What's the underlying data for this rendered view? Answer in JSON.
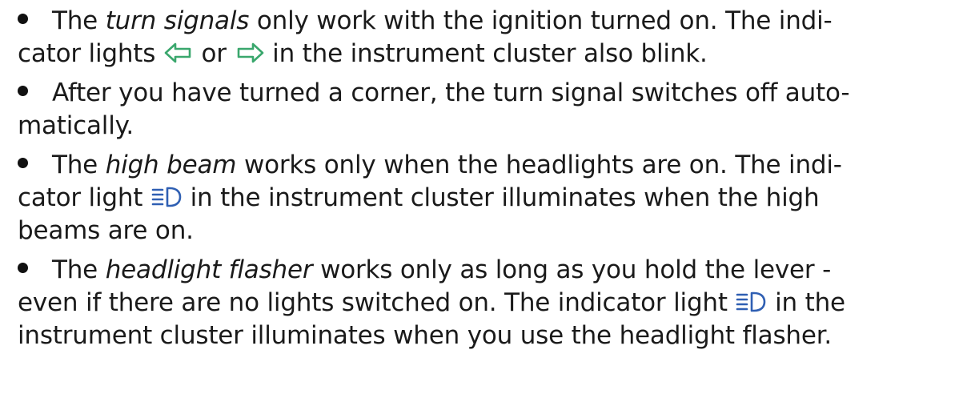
{
  "bullets": [
    {
      "segments": {
        "t1": "The ",
        "em1": "turn signals",
        "t2": " only work with the ignition turned on. The indi-",
        "t3": "cator lights ",
        "t4": " or ",
        "t5": " in the instrument cluster also blink."
      }
    },
    {
      "segments": {
        "t1": "After you have turned a corner, the turn signal switches off auto-",
        "t2": "matically."
      }
    },
    {
      "segments": {
        "t1": "The ",
        "em1": "high beam",
        "t2": " works only when the headlights are on. The indi-",
        "t3": "cator light ",
        "t4": " in the instrument cluster illuminates when the high",
        "t5": "beams are on."
      }
    },
    {
      "segments": {
        "t1": "The ",
        "em1": "headlight flasher",
        "t2": " works only as long as you hold the lever -",
        "t3": "even if there are no lights switched on. The indicator light ",
        "t4": " in the",
        "t5": "instrument cluster illuminates when you use the headlight flasher."
      }
    }
  ],
  "icons": {
    "turn_left": "turn-signal-left-icon",
    "turn_right": "turn-signal-right-icon",
    "high_beam": "high-beam-icon"
  },
  "colors": {
    "text": "#1a1a1a",
    "turn_signal": "#3aa76d",
    "high_beam": "#2f5fb3"
  }
}
